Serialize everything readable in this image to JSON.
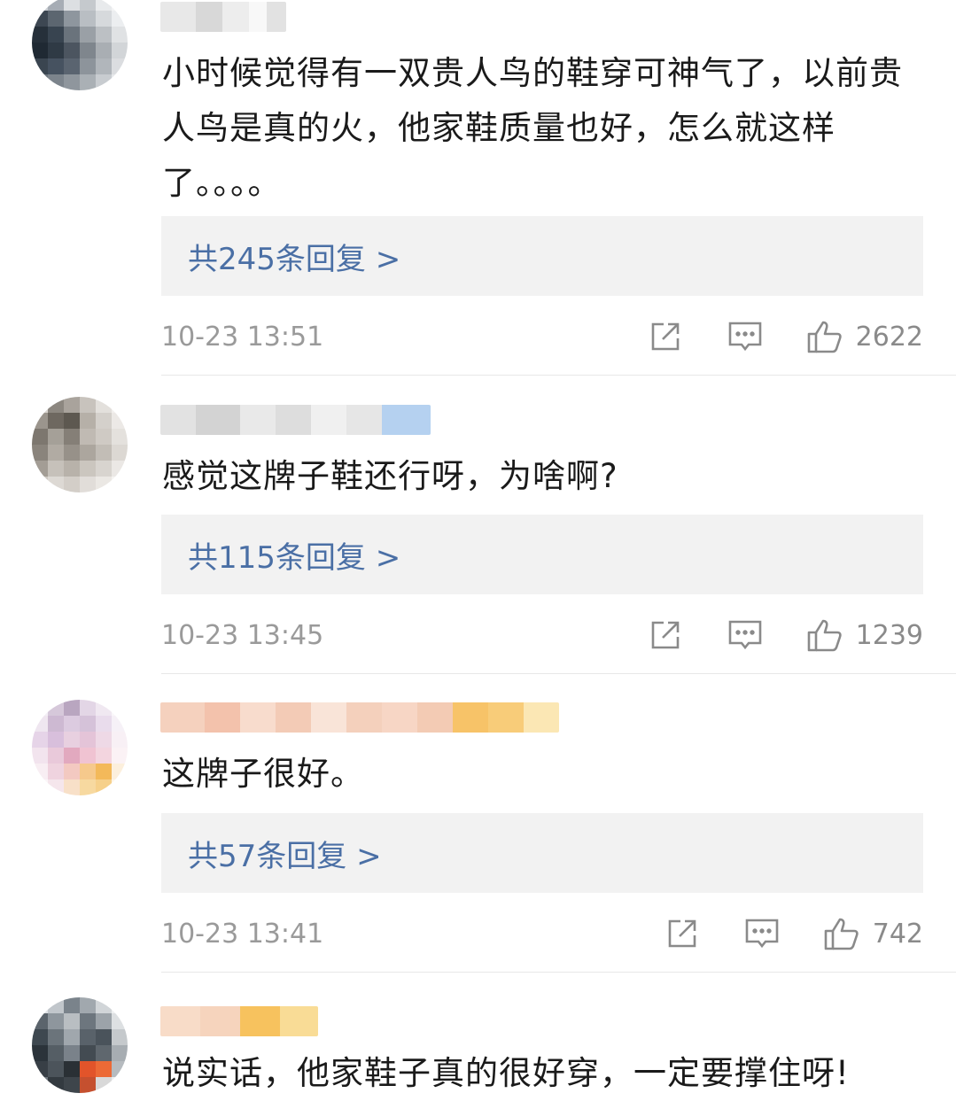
{
  "comments": [
    {
      "text": "小时候觉得有一双贵人鸟的鞋穿可神气了，以前贵人鸟是真的火，他家鞋质量也好，怎么就这样了。。。。",
      "replies_label": "共245条回复 >",
      "timestamp": "10-23 13:51",
      "likes": "2622"
    },
    {
      "text": "感觉这牌子鞋还行呀，为啥啊?",
      "replies_label": "共115条回复 >",
      "timestamp": "10-23 13:45",
      "likes": "1239"
    },
    {
      "text": "这牌子很好。",
      "replies_label": "共57条回复 >",
      "timestamp": "10-23 13:41",
      "likes": "742"
    },
    {
      "text": "说实话，他家鞋子真的很好穿，一定要撑住呀!"
    }
  ],
  "icons": {
    "share": "share-icon",
    "reply": "comment-icon",
    "like": "thumbs-up-icon"
  },
  "colors": {
    "link": "#4a6fa5",
    "reply_box_bg": "#f2f2f2",
    "meta_text": "#9a9a9a",
    "icon_stroke": "#8a8a8a"
  }
}
